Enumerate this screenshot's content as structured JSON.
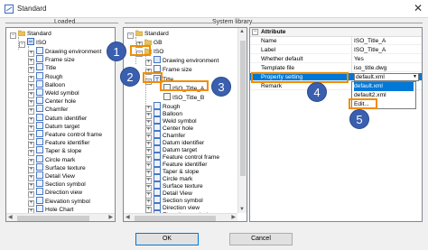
{
  "window": {
    "title": "Standard",
    "close_glyph": "✕"
  },
  "groups": {
    "loaded": "Loaded",
    "library": "System library"
  },
  "loaded_tree": {
    "root": "Standard",
    "standard": "ISO",
    "items": [
      "Drawing environment",
      "Frame size",
      "Title",
      "Rough",
      "Balloon",
      "Weld symbol",
      "Center hole",
      "Chamfer",
      "Datum identifier",
      "Datum target",
      "Feature control frame",
      "Feature identifier",
      "Taper & slope",
      "Circle mark",
      "Surface texture",
      "Detail View",
      "Section symbol",
      "Direction view",
      "Elevation symbol",
      "Hole Chart"
    ]
  },
  "library_tree": {
    "root": "Standard",
    "gb": "GB",
    "iso": "ISO",
    "frame_items": [
      "Drawing environment",
      "Frame size"
    ],
    "title": "Title",
    "title_children": [
      "ISO_Title_A",
      "ISO_Title_B"
    ],
    "items": [
      "Rough",
      "Balloon",
      "Weld symbol",
      "Center hole",
      "Chamfer",
      "Datum identifier",
      "Datum target",
      "Feature control frame",
      "Feature identifier",
      "Taper & slope",
      "Circle mark",
      "Surface texture",
      "Detail View",
      "Section symbol",
      "Direction view",
      "Elevation symbol"
    ]
  },
  "properties": {
    "header": "Attribute",
    "rows": [
      {
        "name": "Name",
        "value": "ISO_Title_A"
      },
      {
        "name": "Label",
        "value": "ISO_Title_A"
      },
      {
        "name": "Whether default",
        "value": "Yes"
      },
      {
        "name": "Template file",
        "value": "iso_title.dwg"
      },
      {
        "name": "Property setting",
        "value": "default.xml"
      },
      {
        "name": "Remark",
        "value": ""
      }
    ],
    "dropdown_options": [
      "default.xml",
      "default2.xml",
      "Edit..."
    ],
    "dropdown_arrow": "▼"
  },
  "callouts": [
    "1",
    "2",
    "3",
    "4",
    "5"
  ],
  "buttons": {
    "ok": "OK",
    "cancel": "Cancel"
  },
  "colors": {
    "highlight": "#f28c00",
    "callout": "#3a5fae",
    "selection": "#0078d7"
  }
}
